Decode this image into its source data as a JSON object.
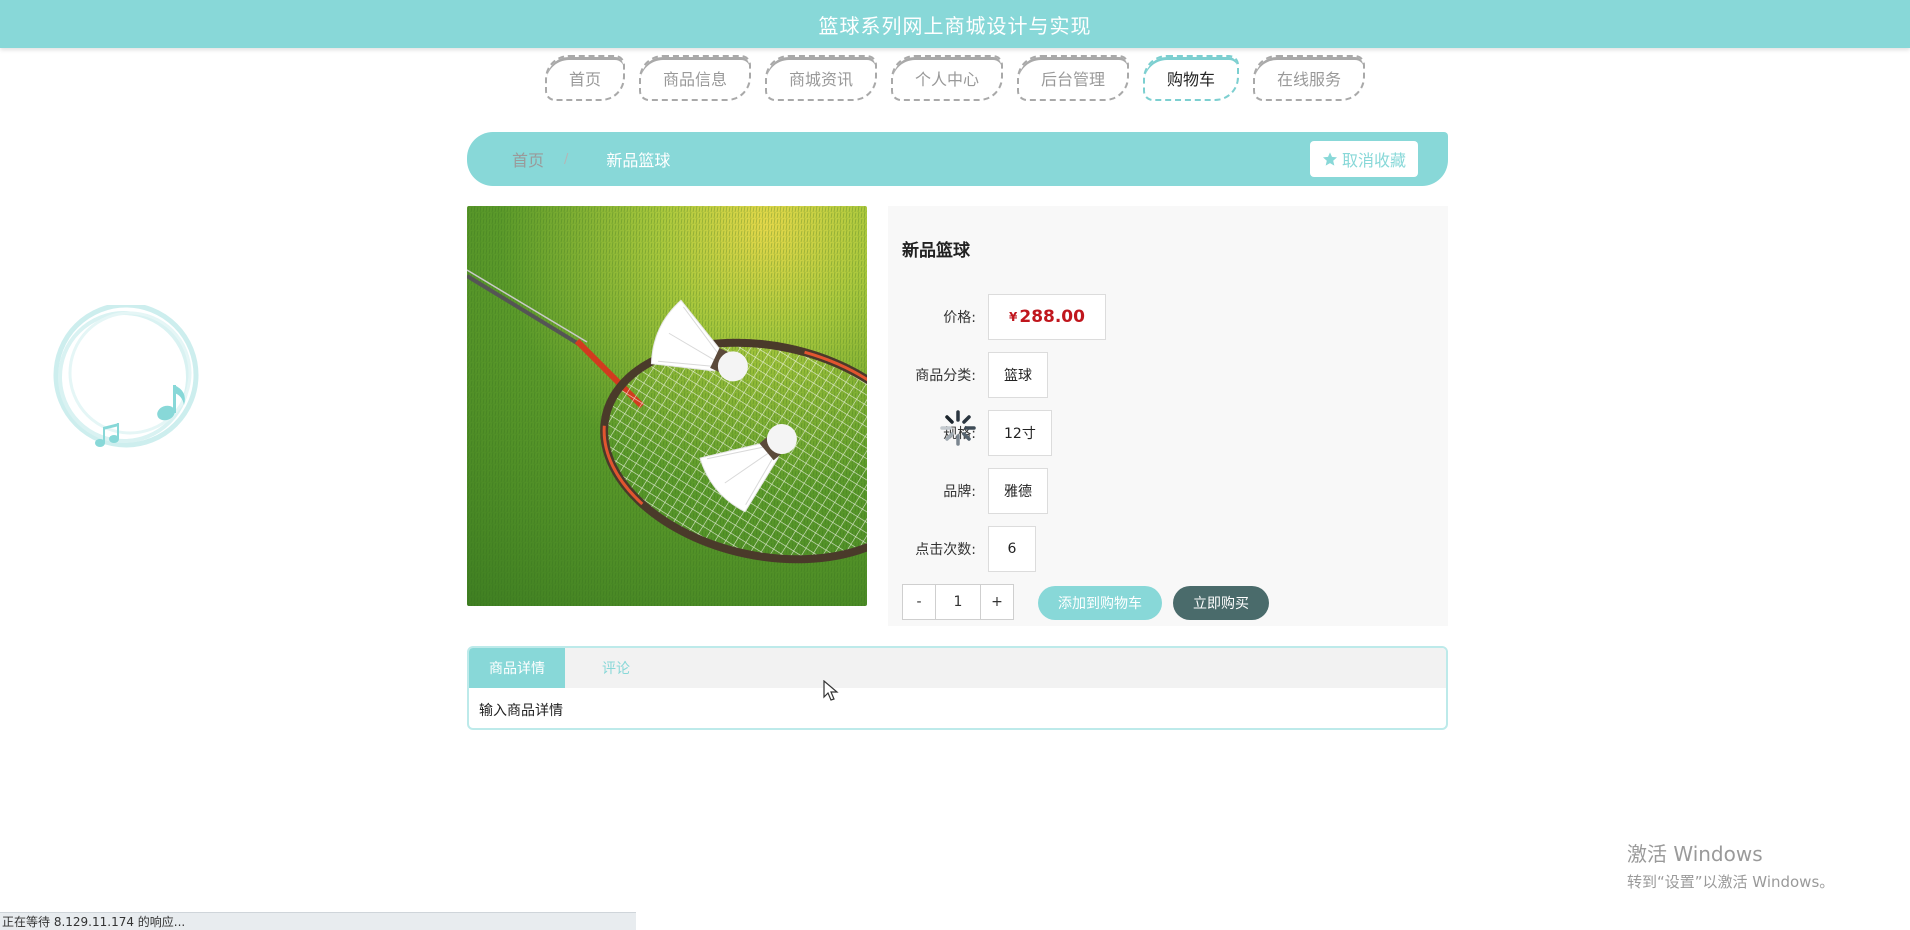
{
  "header": {
    "title": "篮球系列网上商城设计与实现"
  },
  "nav": {
    "items": [
      {
        "label": "首页"
      },
      {
        "label": "商品信息"
      },
      {
        "label": "商城资讯"
      },
      {
        "label": "个人中心"
      },
      {
        "label": "后台管理"
      },
      {
        "label": "购物车",
        "active": true
      },
      {
        "label": "在线服务"
      }
    ]
  },
  "breadcrumb": {
    "home": "首页",
    "separator": "/",
    "current": "新品篮球",
    "favorite_label": "取消收藏",
    "favorite_icon": "star-icon"
  },
  "product": {
    "name": "新品篮球",
    "image_desc_icon": "product-photo",
    "price_label": "价格:",
    "currency": "¥",
    "price": "288.00",
    "category_label": "商品分类:",
    "category": "篮球",
    "spec_label": "规格:",
    "spec": "12寸",
    "brand_label": "品牌:",
    "brand": "雅德",
    "clicks_label": "点击次数:",
    "clicks": "6",
    "quantity": {
      "minus": "-",
      "value": "1",
      "plus": "+"
    },
    "add_to_cart_label": "添加到购物车",
    "buy_now_label": "立即购买"
  },
  "tabs": {
    "items": [
      {
        "label": "商品详情",
        "active": true
      },
      {
        "label": "评论"
      }
    ],
    "content": "输入商品详情"
  },
  "watermark": {
    "title": "激活 Windows",
    "subtitle": "转到“设置”以激活 Windows。"
  },
  "status_bar": {
    "text": "正在等待 8.129.11.174 的响应..."
  },
  "colors": {
    "accent": "#88d8d8",
    "price": "#c0161d",
    "buy_button": "#4a6b6b"
  }
}
